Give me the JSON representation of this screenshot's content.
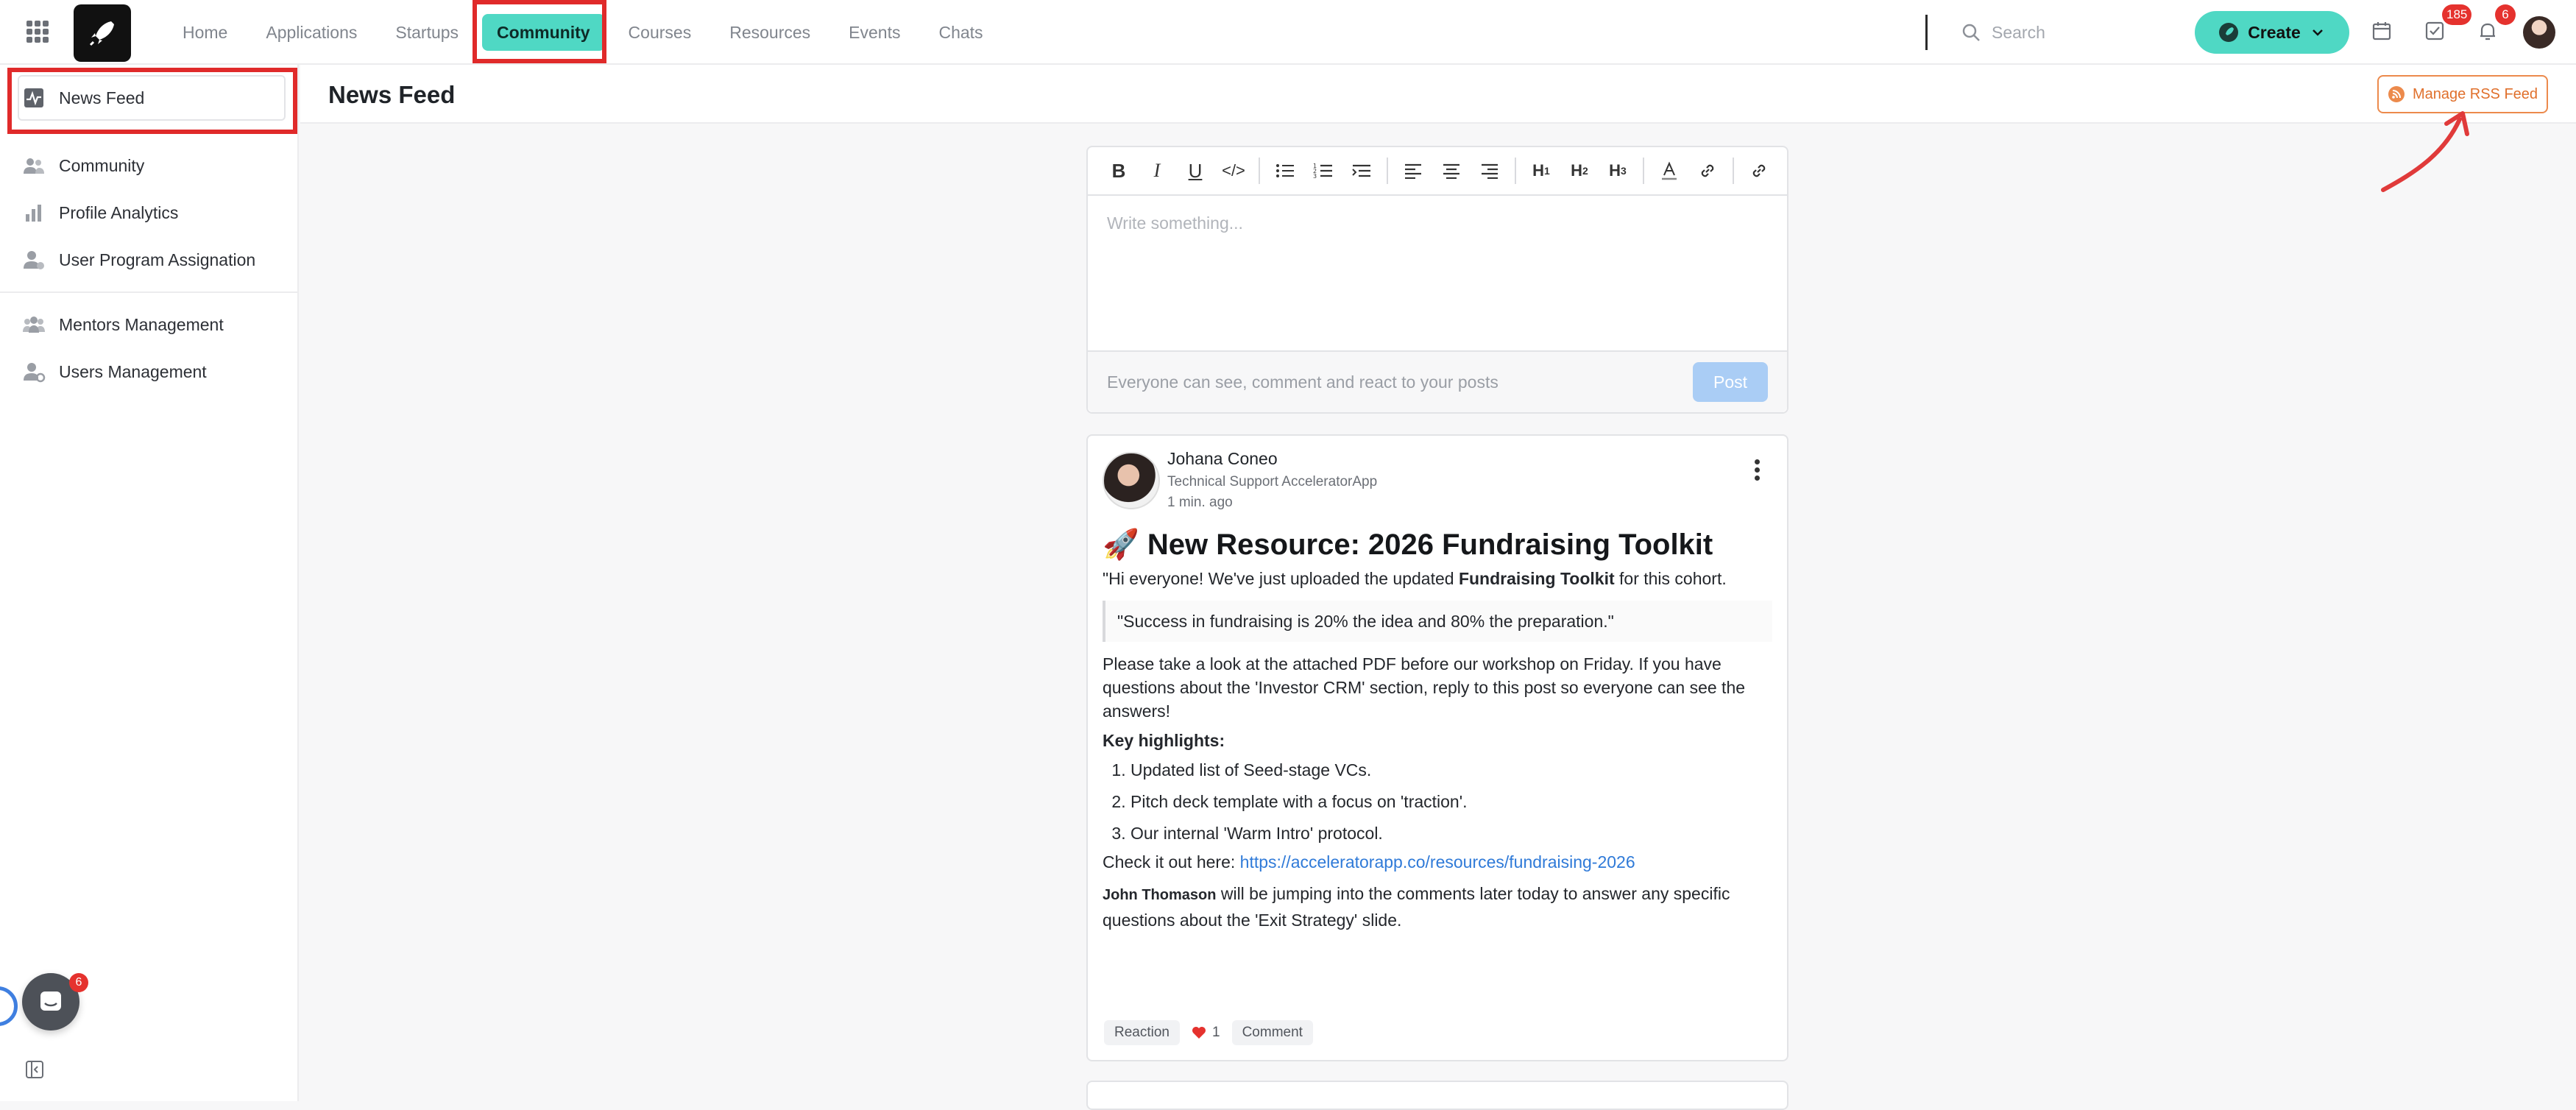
{
  "nav": {
    "items": [
      "Home",
      "Applications",
      "Startups",
      "Community",
      "Courses",
      "Resources",
      "Events",
      "Chats"
    ],
    "active": "Community"
  },
  "search": {
    "placeholder": "Search"
  },
  "create": {
    "label": "Create"
  },
  "badges": {
    "tasks": "185",
    "notifications": "6",
    "chat": "6"
  },
  "sidebar": {
    "items": [
      {
        "label": "News Feed",
        "icon": "activity-icon"
      },
      {
        "label": "Community",
        "icon": "users-icon"
      },
      {
        "label": "Profile Analytics",
        "icon": "bar-chart-icon"
      },
      {
        "label": "User Program Assignation",
        "icon": "user-assign-icon"
      },
      {
        "label": "Mentors Management",
        "icon": "group-icon"
      },
      {
        "label": "Users Management",
        "icon": "user-cog-icon"
      }
    ]
  },
  "header": {
    "title": "News Feed",
    "rss_label": "Manage RSS Feed"
  },
  "editor": {
    "placeholder": "Write something...",
    "footer_note": "Everyone can see, comment and react to your posts",
    "post_label": "Post"
  },
  "post": {
    "author": "Johana Coneo",
    "role": "Technical Support AcceleratorApp",
    "time": "1 min. ago",
    "heading": "🚀 New Resource: 2026 Fundraising Toolkit",
    "intro_pre": "\"Hi everyone! We've just uploaded the updated ",
    "intro_bold": "Fundraising Toolkit",
    "intro_post": " for this cohort.",
    "quote": "\"Success in fundraising is 20% the idea and 80% the preparation.\"",
    "paragraph": "Please take a look at the attached PDF before our workshop on Friday. If you have questions about the 'Investor CRM' section, reply to this post so everyone can see the answers!",
    "highlights_title": "Key highlights:",
    "highlights": [
      "Updated list of Seed-stage VCs.",
      "Pitch deck template with a focus on 'traction'.",
      "Our internal 'Warm Intro' protocol."
    ],
    "link_prefix": "Check it out here: ",
    "link": "https://acceleratorapp.co/resources/fundraising-2026",
    "mention": "John Thomason",
    "mention_text": " will be jumping into the comments later today to answer any specific questions about the 'Exit Strategy' slide.",
    "reaction_label": "Reaction",
    "reaction_count": "1",
    "comment_label": "Comment"
  },
  "colors": {
    "accent": "#4fd8c4",
    "highlight": "#e02a2a",
    "rss": "#e0702c"
  }
}
